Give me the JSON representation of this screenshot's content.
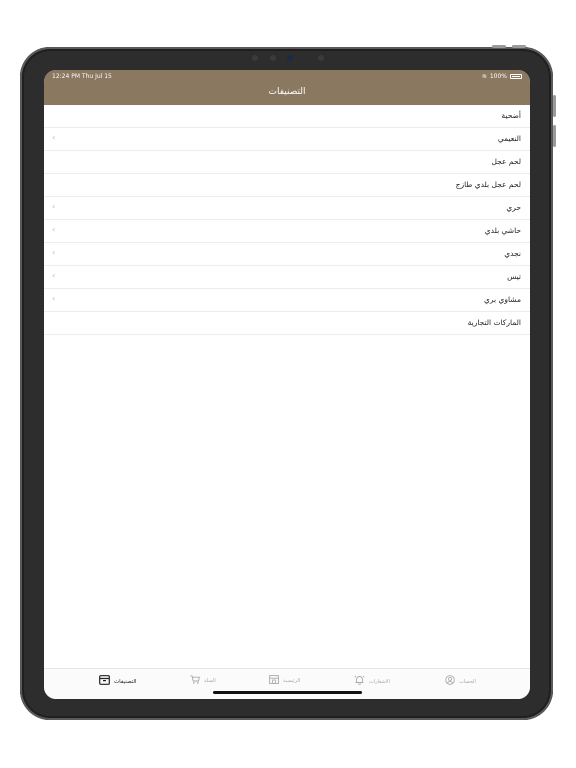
{
  "status_bar": {
    "time": "12:24 PM  Thu Jul 15",
    "battery": "100%"
  },
  "header": {
    "title": "التصنيفات"
  },
  "categories": [
    {
      "label": "أضحية",
      "has_chevron": false
    },
    {
      "label": "النعيمي",
      "has_chevron": true
    },
    {
      "label": "لحم عجل",
      "has_chevron": false
    },
    {
      "label": "لحم عجل بلدي طازج",
      "has_chevron": false
    },
    {
      "label": "حري",
      "has_chevron": true
    },
    {
      "label": "حاشي بلدي",
      "has_chevron": true
    },
    {
      "label": "نجدي",
      "has_chevron": true
    },
    {
      "label": "تيس",
      "has_chevron": true
    },
    {
      "label": "مشاوي بري",
      "has_chevron": true
    },
    {
      "label": "الماركات التجارية",
      "has_chevron": false
    }
  ],
  "tabbar": {
    "categories": "التصنيفات",
    "cart": "السلة",
    "home": "الرئيسية",
    "notifications": "الاشعارات",
    "account": "الحساب"
  },
  "colors": {
    "header_bg": "#8a7861",
    "active_tab": "#222222",
    "inactive_tab": "#a8a8a8"
  }
}
